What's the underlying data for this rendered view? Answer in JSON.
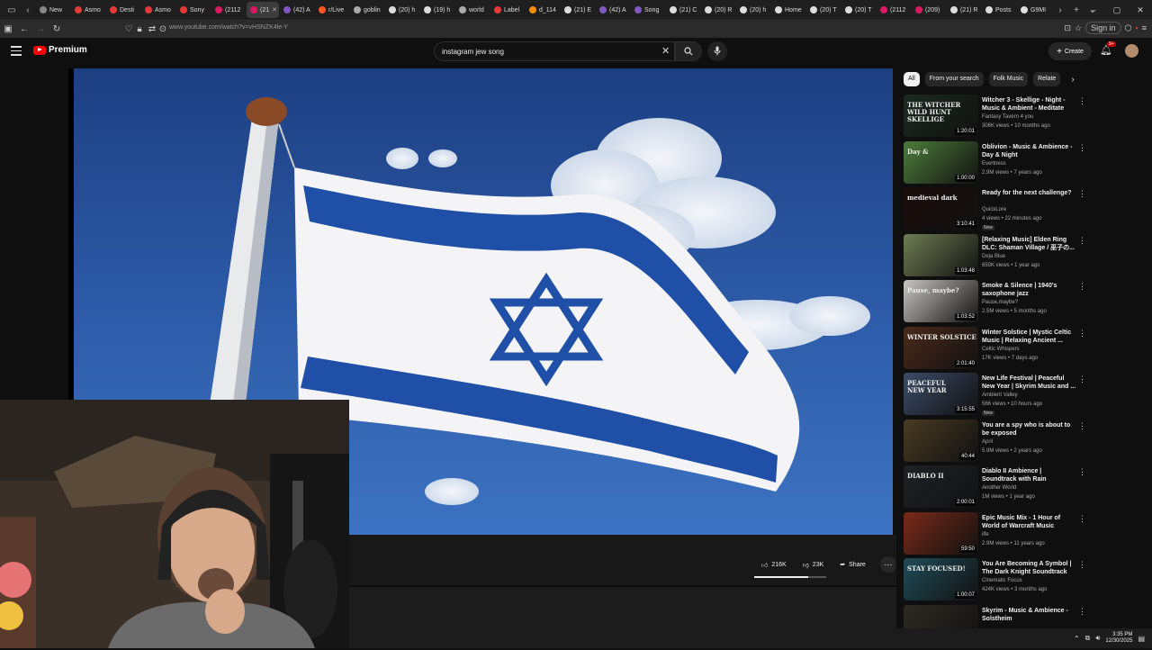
{
  "browser": {
    "tabs": [
      {
        "label": "New",
        "color": "#888888"
      },
      {
        "label": "Asmo",
        "color": "#e53935"
      },
      {
        "label": "Desti",
        "color": "#e53935"
      },
      {
        "label": "Asmo",
        "color": "#e53935"
      },
      {
        "label": "Sony",
        "color": "#e53935"
      },
      {
        "label": "(2112",
        "color": "#d81b60"
      },
      {
        "label": "(21",
        "color": "#d81b60",
        "active": true
      },
      {
        "label": "(42) A",
        "color": "#7e57c2"
      },
      {
        "label": "r/Live",
        "color": "#ff5722"
      },
      {
        "label": "goblin",
        "color": "#aaaaaa"
      },
      {
        "label": "(20) h",
        "color": "#dddddd"
      },
      {
        "label": "(19) h",
        "color": "#dddddd"
      },
      {
        "label": "world",
        "color": "#aaaaaa"
      },
      {
        "label": "Label",
        "color": "#e53935"
      },
      {
        "label": "d_114",
        "color": "#fb8c00"
      },
      {
        "label": "(21) E",
        "color": "#dddddd"
      },
      {
        "label": "(42) A",
        "color": "#7e57c2"
      },
      {
        "label": "Song",
        "color": "#7e57c2"
      },
      {
        "label": "(21) C",
        "color": "#dddddd"
      },
      {
        "label": "(20) R",
        "color": "#dddddd"
      },
      {
        "label": "(20) h",
        "color": "#dddddd"
      },
      {
        "label": "Home",
        "color": "#dddddd"
      },
      {
        "label": "(20) T",
        "color": "#dddddd"
      },
      {
        "label": "(20) T",
        "color": "#dddddd"
      },
      {
        "label": "(2112",
        "color": "#d81b60"
      },
      {
        "label": "(209)",
        "color": "#d81b60"
      },
      {
        "label": "(21) R",
        "color": "#dddddd"
      },
      {
        "label": "Posts",
        "color": "#dddddd"
      },
      {
        "label": "G9MI",
        "color": "#dddddd"
      }
    ],
    "url": "www.youtube.com/watch?v=vHSNZK4le-Y",
    "sign_in": "Sign in"
  },
  "youtube": {
    "logo_text": "Premium",
    "search_value": "instagram jew song",
    "create_label": "Create",
    "notif_badge": "9+"
  },
  "video_actions": {
    "likes": "216K",
    "dislikes": "23K",
    "share": "Share"
  },
  "chips": [
    "All",
    "From your search",
    "Folk Music",
    "Relate"
  ],
  "recs": [
    {
      "title": "Witcher 3 - Skellige - Night - Music & Ambient - Meditate lik...",
      "channel": "Fantasy Tavern 4 you",
      "meta": "306K views • 10 months ago",
      "duration": "1:20:01",
      "thumb_bg": "#1b2a20",
      "thumb_text": "THE WITCHER\nWILD HUNT\nSKELLIGE"
    },
    {
      "title": "Oblivion - Music & Ambience - Day & Night",
      "channel": "Evertness",
      "meta": "2.9M views • 7 years ago",
      "duration": "1:00:00",
      "thumb_bg": "#4d7c3a",
      "thumb_text": "Day &"
    },
    {
      "title": "Ready for the next challenge?",
      "channel": "QuickLore",
      "meta": "4 views • 22 minutes ago",
      "duration": "3:10:41",
      "badge": "New",
      "thumb_bg": "#1a0c0a",
      "thumb_text": "medieval dark"
    },
    {
      "title": "[Relaxing Music] Elden Ring DLC: Shaman Village / 巫子の...",
      "channel": "Deja Blue",
      "meta": "650K views • 1 year ago",
      "duration": "1:03:48",
      "thumb_bg": "#6f7d52",
      "thumb_text": ""
    },
    {
      "title": "Smoke & Silence | 1940's saxophone jazz",
      "channel": "Pause,maybe?",
      "meta": "2.5M views • 5 months ago",
      "duration": "1:03:52",
      "thumb_bg": "#c9c7c2",
      "thumb_text": "Pause, maybe?"
    },
    {
      "title": "Winter Solstice | Mystic Celtic Music | Relaxing Ancient ...",
      "channel": "Celtic Whispers",
      "meta": "17K views • 7 days ago",
      "duration": "2:01:40",
      "thumb_bg": "#4a2a1a",
      "thumb_text": "WINTER SOLSTICE"
    },
    {
      "title": "New Life Festival | Peaceful New Year | Skyrim Music and ...",
      "channel": "Ambient Valley",
      "meta": "566 views • 10 hours ago",
      "duration": "3:15:55",
      "badge": "New",
      "thumb_bg": "#3b4c68",
      "thumb_text": "PEACEFUL\nNEW YEAR"
    },
    {
      "title": "You are a spy who is about to be exposed",
      "channel": "April",
      "meta": "5.9M views • 2 years ago",
      "duration": "40:44",
      "thumb_bg": "#4a3b22",
      "thumb_text": ""
    },
    {
      "title": "Diablo II Ambience | Soundtrack with Rain Background | Relax i...",
      "channel": "Another World",
      "meta": "1M views • 1 year ago",
      "duration": "2:00:01",
      "thumb_bg": "#1e2226",
      "thumb_text": "DIABLO II"
    },
    {
      "title": "Epic Music Mix - 1 Hour of World of Warcraft Music",
      "channel": "ilfe",
      "meta": "2.9M views • 11 years ago",
      "duration": "59:50",
      "thumb_bg": "#7a2a18",
      "thumb_text": ""
    },
    {
      "title": "You Are Becoming A Symbol | The Dark Knight Soundtrack",
      "channel": "Cinematic Focus",
      "meta": "424K views • 3 months ago",
      "duration": "1:00:07",
      "thumb_bg": "#1f4c58",
      "thumb_text": "STAY FOCUSED!"
    },
    {
      "title": "Skyrim - Music & Ambience - Solstheim",
      "channel": "",
      "meta": "",
      "duration": "",
      "thumb_bg": "#2e2a22",
      "thumb_text": ""
    }
  ],
  "clock": {
    "time": "3:35 PM",
    "date": "12/30/2025"
  }
}
